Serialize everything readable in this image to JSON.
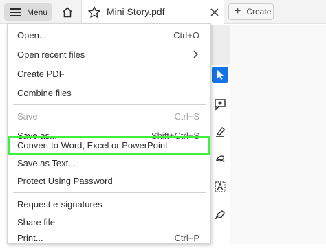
{
  "topbar": {
    "menu_label": "Menu",
    "tab_title": "Mini Story.pdf",
    "create_label": "Create"
  },
  "menu": {
    "items": [
      {
        "label": "Open...",
        "shortcut": "Ctrl+O"
      },
      {
        "label": "Open recent files",
        "shortcut": ""
      },
      {
        "label": "Create PDF",
        "shortcut": ""
      },
      {
        "label": "Combine files",
        "shortcut": ""
      },
      {
        "label": "Save",
        "shortcut": "Ctrl+S"
      },
      {
        "label": "Save as...",
        "shortcut": "Shift+Ctrl+S"
      },
      {
        "label": "Convert to Word, Excel or PowerPoint",
        "shortcut": ""
      },
      {
        "label": "Save as Text...",
        "shortcut": ""
      },
      {
        "label": "Protect Using Password",
        "shortcut": ""
      },
      {
        "label": "Request e-signatures",
        "shortcut": ""
      },
      {
        "label": "Share file",
        "shortcut": ""
      },
      {
        "label": "Print...",
        "shortcut": "Ctrl+P"
      }
    ]
  },
  "colors": {
    "accent": "#1473e6",
    "highlight": "#3cf03c",
    "disabled_text": "#a3a3a3"
  },
  "icons": [
    "hamburger-icon",
    "home-icon",
    "star-icon",
    "close-icon",
    "plus-icon",
    "chevron-right-icon",
    "select-cursor-icon",
    "comment-icon",
    "highlight-pen-icon",
    "draw-icon",
    "text-box-icon",
    "sign-icon"
  ]
}
